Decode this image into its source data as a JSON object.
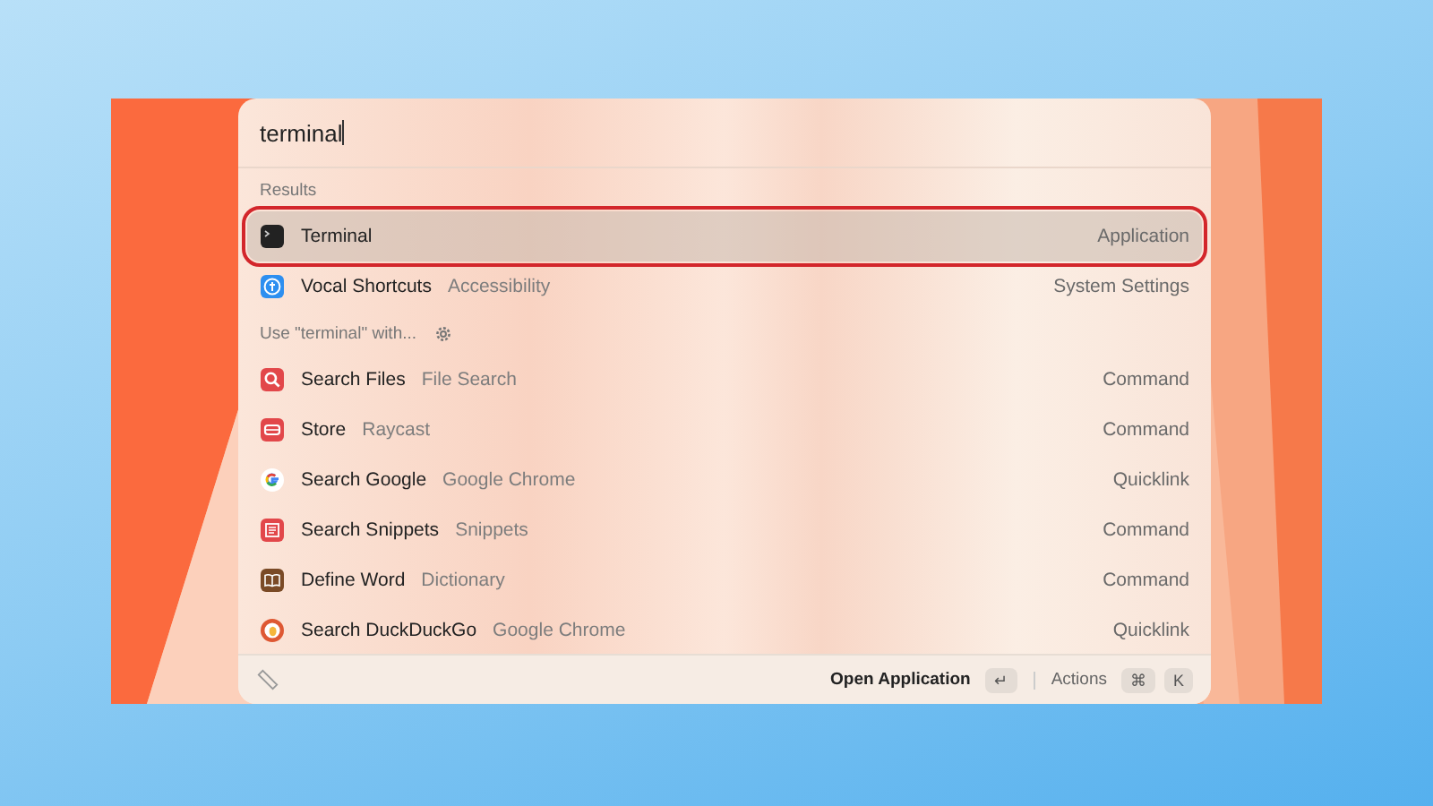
{
  "search": {
    "value": "terminal"
  },
  "sections": [
    {
      "title": "Results",
      "kind": "results",
      "items": [
        {
          "kind": "terminal",
          "title": "Terminal",
          "accessory": "Application",
          "selected": true
        },
        {
          "kind": "accessibility",
          "title": "Vocal Shortcuts",
          "subtitle": "Accessibility",
          "accessory": "System Settings",
          "selected": false
        }
      ]
    },
    {
      "title": "Use \"terminal\" with...",
      "kind": "fallback",
      "items": [
        {
          "kind": "search",
          "title": "Search Files",
          "subtitle": "File Search",
          "accessory": "Command",
          "selected": false
        },
        {
          "kind": "store",
          "title": "Store",
          "subtitle": "Raycast",
          "accessory": "Command",
          "selected": false
        },
        {
          "kind": "google",
          "title": "Search Google",
          "subtitle": "Google Chrome",
          "accessory": "Quicklink",
          "selected": false
        },
        {
          "kind": "snippets",
          "title": "Search Snippets",
          "subtitle": "Snippets",
          "accessory": "Command",
          "selected": false
        },
        {
          "kind": "dictionary",
          "title": "Define Word",
          "subtitle": "Dictionary",
          "accessory": "Command",
          "selected": false
        },
        {
          "kind": "duckduckgo",
          "title": "Search DuckDuckGo",
          "subtitle": "Google Chrome",
          "accessory": "Quicklink",
          "selected": false
        }
      ]
    }
  ],
  "footer": {
    "action": "Open Application",
    "action_key": "↵",
    "actions": "Actions",
    "actions_keys": [
      "⌘",
      "K"
    ]
  }
}
